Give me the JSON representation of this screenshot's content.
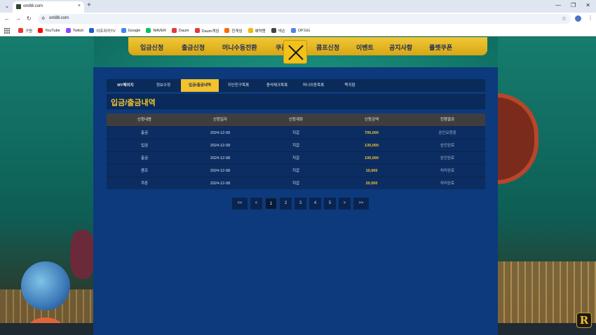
{
  "browser": {
    "tab_title": "om88.com",
    "tab_close": "×",
    "new_tab": "+",
    "dropdown": "⌄",
    "url": "om88.com",
    "win_min": "—",
    "win_max": "❐",
    "win_close": "✕",
    "nav_back": "←",
    "nav_forward": "→",
    "nav_reload": "↻",
    "site_info_icon": "⚙",
    "star": "☆",
    "menu": "⋮"
  },
  "bookmarks": [
    {
      "label": "구원",
      "color": "#e53935"
    },
    {
      "label": "YouTube",
      "color": "#ff0000"
    },
    {
      "label": "Twitch",
      "color": "#9146ff"
    },
    {
      "label": "아프리카TV",
      "color": "#1a5fd0"
    },
    {
      "label": "Google",
      "color": "#4285f4"
    },
    {
      "label": "NAVER",
      "color": "#03c75a"
    },
    {
      "label": "Daum",
      "color": "#e53935"
    },
    {
      "label": "Daum게임",
      "color": "#e53935"
    },
    {
      "label": "한게임",
      "color": "#ff6a00"
    },
    {
      "label": "예약봄",
      "color": "#f2b705"
    },
    {
      "label": "넥슨",
      "color": "#444444"
    },
    {
      "label": "OP.GG",
      "color": "#5383e8"
    }
  ],
  "topnav": {
    "items": [
      "입금신청",
      "출금신청",
      "머니수동전환",
      "쿠폰",
      "콤프신청",
      "이벤트",
      "공지사항",
      "룰렛쿠폰"
    ]
  },
  "subtabs": [
    "MY페이지",
    "정보수정",
    "입금/출금내역",
    "지인친구목록",
    "충석체크목록",
    "머니이동목록",
    "쪽지함"
  ],
  "active_subtab": 2,
  "section": {
    "title": "입금/출금내역"
  },
  "table": {
    "headers": [
      "신청내용",
      "신청일자",
      "신청계좌",
      "신청금액",
      "진행결과"
    ],
    "rows": [
      [
        "출금",
        "2024-12-09",
        "지갑",
        "700,000",
        "승인요청중"
      ],
      [
        "입금",
        "2024-12-09",
        "지갑",
        "130,000",
        "승인완료"
      ],
      [
        "출금",
        "2024-12-08",
        "지갑",
        "100,000",
        "승인완료"
      ],
      [
        "콤프",
        "2024-12-08",
        "지갑",
        "10,000",
        "처리완료"
      ],
      [
        "쿠폰",
        "2024-12-08",
        "지갑",
        "20,000",
        "처리완료"
      ]
    ]
  },
  "pager": {
    "first": "<<",
    "prev": "<",
    "pages": [
      "1",
      "2",
      "3",
      "4",
      "5"
    ],
    "active": 0,
    "next": ">",
    "last": ">>"
  },
  "badge": "R",
  "colors": {
    "accent": "#f3c22c",
    "panel": "#0c3a7c",
    "nav": "#f0c836"
  }
}
